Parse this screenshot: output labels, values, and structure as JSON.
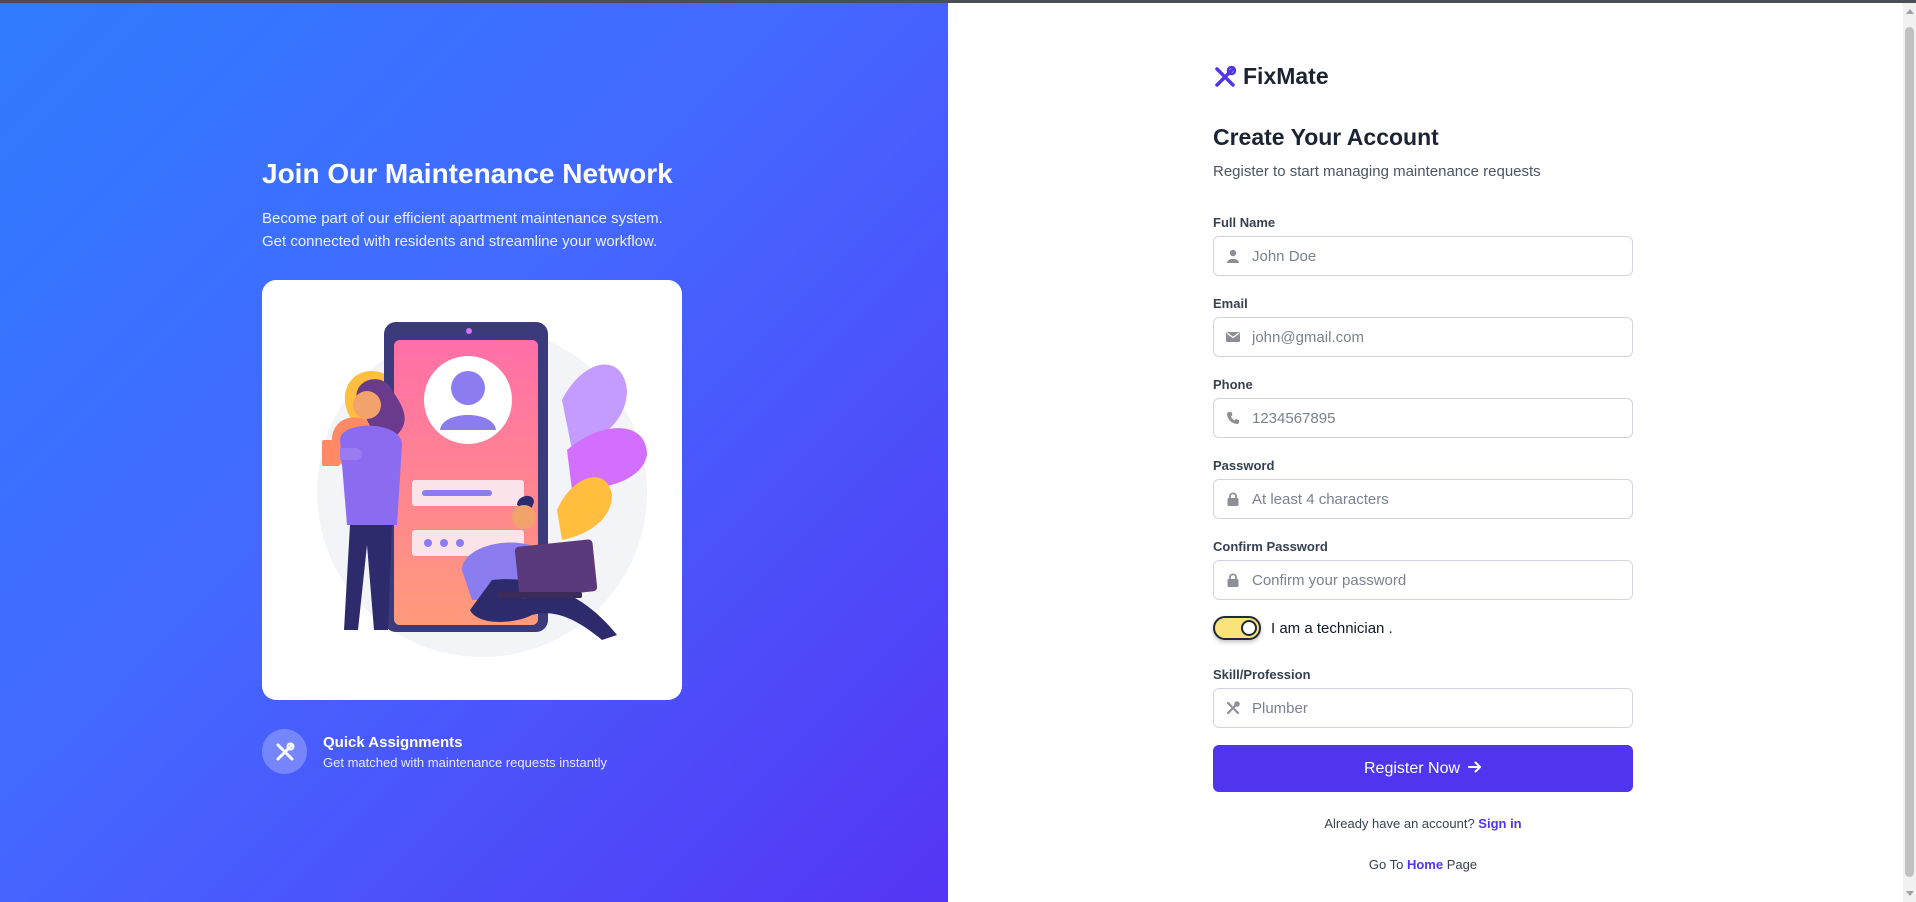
{
  "brand": {
    "name": "FixMate",
    "accent_color": "#4f35ee"
  },
  "left_panel": {
    "title": "Join Our Maintenance Network",
    "subtitle_line1": "Become part of our efficient apartment maintenance system.",
    "subtitle_line2": "Get connected with residents and streamline your workflow.",
    "illustration_icon": "registration-illustration",
    "feature": {
      "icon": "tools-icon",
      "title": "Quick Assignments",
      "description": "Get matched with maintenance requests instantly"
    }
  },
  "form": {
    "heading": "Create Your Account",
    "subheading": "Register to start managing maintenance requests",
    "fields": {
      "full_name": {
        "label": "Full Name",
        "placeholder": "John Doe",
        "icon": "user-icon"
      },
      "email": {
        "label": "Email",
        "placeholder": "john@gmail.com",
        "icon": "envelope-icon"
      },
      "phone": {
        "label": "Phone",
        "placeholder": "1234567895",
        "icon": "phone-icon"
      },
      "password": {
        "label": "Password",
        "placeholder": "At least 4 characters",
        "icon": "lock-icon"
      },
      "confirm_password": {
        "label": "Confirm Password",
        "placeholder": "Confirm your password",
        "icon": "lock-icon"
      },
      "skill": {
        "label": "Skill/Profession",
        "placeholder": "Plumber",
        "icon": "tools-icon"
      }
    },
    "technician_toggle": {
      "label": "I am a technician .",
      "checked": true
    },
    "register_button": "Register Now",
    "signin_prompt": "Already have an account?",
    "signin_link": "Sign in",
    "home_prefix": "Go To",
    "home_link": "Home",
    "home_suffix": "Page"
  }
}
